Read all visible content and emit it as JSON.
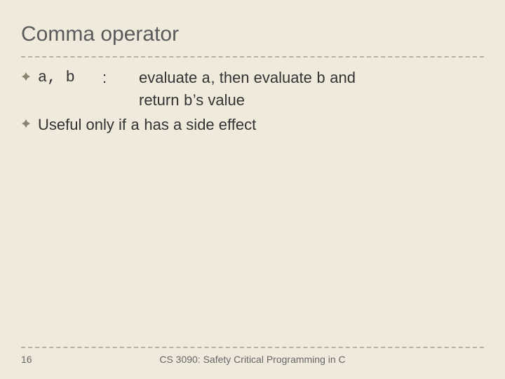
{
  "title": "Comma operator",
  "bullets": {
    "b1": {
      "code": "a, b",
      "sep": ":",
      "desc_l1_pre": "evaluate ",
      "desc_l1_code1": "a",
      "desc_l1_mid": ", then evaluate ",
      "desc_l1_code2": "b",
      "desc_l1_post": " and",
      "desc_l2_pre": "return ",
      "desc_l2_code": "b",
      "desc_l2_post": "’s value"
    },
    "b2": {
      "pre": "Useful only if ",
      "code": "a",
      "post": " has a side effect"
    }
  },
  "footer": {
    "page": "16",
    "text": "CS 3090: Safety Critical Programming in C"
  }
}
